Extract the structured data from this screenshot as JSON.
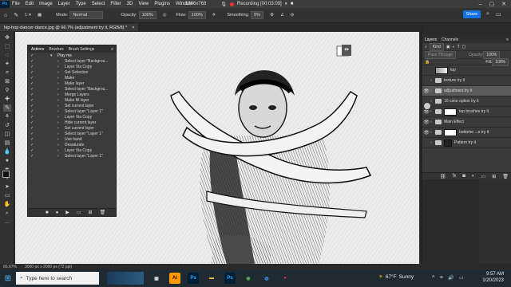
{
  "menubar": {
    "logo": "Ps",
    "items": [
      "File",
      "Edit",
      "Image",
      "Layer",
      "Type",
      "Select",
      "Filter",
      "3D",
      "View",
      "Plugins",
      "Window"
    ],
    "resolution": "1366x768",
    "recording": "Recording [00:03:09]"
  },
  "options": {
    "mode_label": "Mode:",
    "mode_value": "Normal",
    "opacity_label": "Opacity:",
    "opacity_value": "100%",
    "flow_label": "Flow:",
    "flow_value": "100%",
    "smoothing_label": "Smoothing:",
    "smoothing_value": "0%",
    "brush_size": "1",
    "share": "Share"
  },
  "document": {
    "tab_title": "hip-hop-dancer-dance.jpg @ 66.7% (adjustment try it, RGB/8) *",
    "close": "×"
  },
  "actions_panel": {
    "tabs": [
      "Actions",
      "Brushes",
      "Brush Settings"
    ],
    "set_name": "Play me",
    "steps": [
      "Select layer \"Backgrou...",
      "Layer Via Copy",
      "Set Selection",
      "Make",
      "Make layer",
      "Select layer \"Backgrou...",
      "Merge Layers",
      "Make fill layer",
      "Set current layer",
      "Select layer \"Layer 1\"",
      "Layer Via Copy",
      "Hide current layer",
      "Set current layer",
      "Select layer \"Layer 1\"",
      "Use hand",
      "Desaturate",
      "Layer Via Copy",
      "Select layer \"Layer 1\""
    ]
  },
  "layers_panel": {
    "tabs": [
      "Layers",
      "Channels"
    ],
    "filter_label": "Kind",
    "blend_mode": "Pass Through",
    "opacity_label": "Opacity:",
    "opacity_value": "100%",
    "fill_label": "Fill:",
    "fill_value": "100%",
    "layers": [
      {
        "name": "top",
        "type": "image",
        "visible": false
      },
      {
        "name": "texture try it",
        "type": "folder",
        "visible": false
      },
      {
        "name": "adjustment try it",
        "type": "folder",
        "visible": true,
        "selected": true
      },
      {
        "name": "10 color option try it",
        "type": "folder",
        "visible": false
      },
      {
        "name": "top brushes try it",
        "type": "folder",
        "visible": true
      },
      {
        "name": "Main Effect",
        "type": "folder",
        "visible": true
      },
      {
        "name": "bottome ...e try it",
        "type": "folder",
        "visible": true
      },
      {
        "name": "Pattern try it",
        "type": "folder",
        "visible": false
      }
    ]
  },
  "statusbar": {
    "zoom": "66.67%",
    "doc_info": "3000 px x 2000 px (72 ppi)"
  },
  "taskbar": {
    "search_placeholder": "Type here to search",
    "weather_temp": "67°F",
    "weather_text": "Sunny",
    "time": "9:57 AM",
    "date": "1/20/2023"
  },
  "colors": {
    "accent": "#1473e6",
    "ps_blue": "#31a8ff",
    "panel_bg": "#3a3a3a"
  }
}
